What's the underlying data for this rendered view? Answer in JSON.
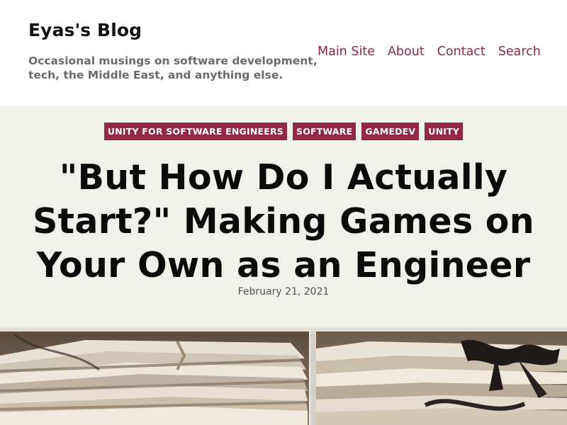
{
  "header": {
    "site_title": "Eyas's Blog",
    "tagline": "Occasional musings on software development, tech, the Middle East, and anything else.",
    "nav": [
      {
        "label": "Main Site"
      },
      {
        "label": "About"
      },
      {
        "label": "Contact"
      },
      {
        "label": "Search"
      }
    ]
  },
  "post": {
    "tags": [
      {
        "label": "UNITY FOR SOFTWARE ENGINEERS"
      },
      {
        "label": "SOFTWARE"
      },
      {
        "label": "GAMEDEV"
      },
      {
        "label": "UNITY"
      }
    ],
    "title": "\"But How Do I Actually Start?\" Making Games on Your Own as an Engineer",
    "date": "February 21, 2021",
    "featured_image_icon": "stacked-papers-photo"
  },
  "colors": {
    "accent": "#922746",
    "nav_link": "#8b2a45",
    "hero_bg": "#f1f1ec",
    "tagline": "#6b6b6b"
  }
}
